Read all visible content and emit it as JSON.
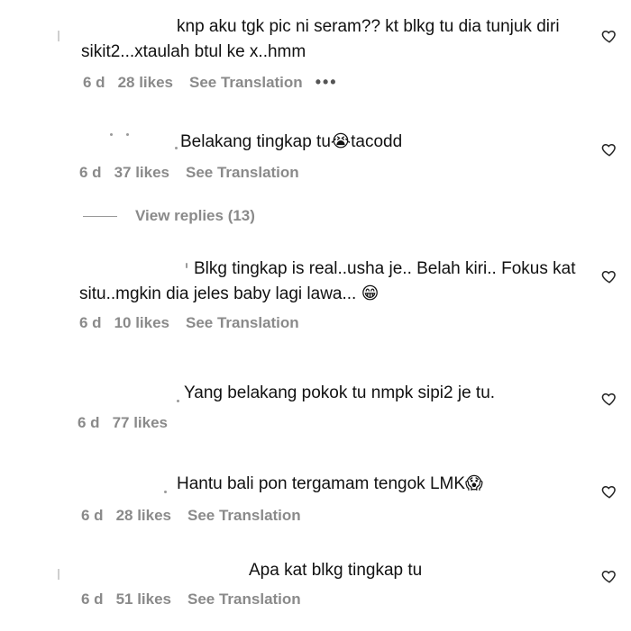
{
  "comments": [
    {
      "text": "knp aku tgk pic ni seram?? kt blkg tu dia tunjuk diri sikit2...xtaulah btul ke x..hmm",
      "time": "6 d",
      "likes": "28 likes",
      "translate": "See Translation",
      "more": "•••"
    },
    {
      "text": "Belakang tingkap tu😭tacodd",
      "time": "6 d",
      "likes": "37 likes",
      "translate": "See Translation"
    },
    {
      "text": "Blkg tingkap is real..usha je.. Belah kiri.. Fokus kat situ..mgkin dia jeles baby lagi lawa... 😁",
      "time": "6 d",
      "likes": "10 likes",
      "translate": "See Translation"
    },
    {
      "text": "Yang belakang pokok tu nmpk sipi2 je tu.",
      "time": "6 d",
      "likes": "77 likes"
    },
    {
      "text": "Hantu bali pon tergamam tengok LMK😱",
      "time": "6 d",
      "likes": "28 likes",
      "translate": "See Translation"
    },
    {
      "text": "Apa kat blkg tingkap tu",
      "time": "6 d",
      "likes": "51 likes",
      "translate": "See Translation"
    }
  ],
  "view_replies": "View replies (13)",
  "icons": {
    "like": "heart-outline-icon"
  },
  "colors": {
    "text": "#111111",
    "meta": "#8a8a8a",
    "icon": "#262626"
  }
}
